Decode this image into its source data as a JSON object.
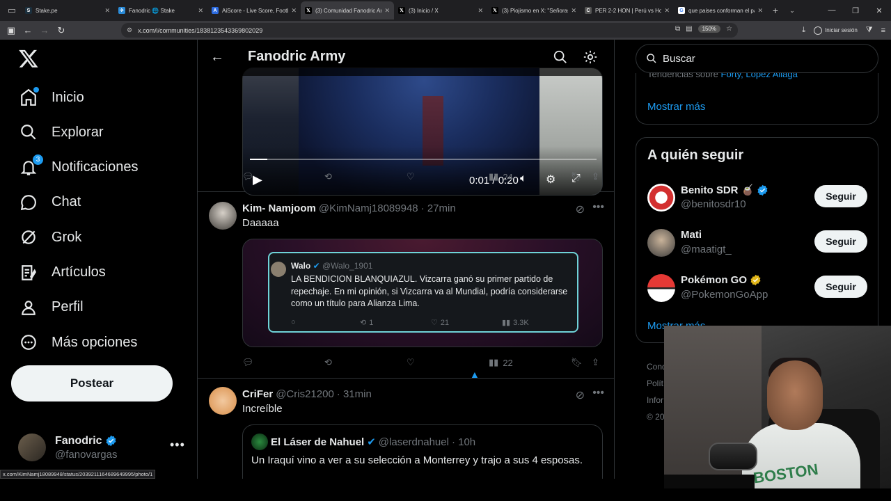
{
  "browser": {
    "tabs": [
      {
        "title": "Stake.pe",
        "color": "#1b2f3d",
        "glyph": "S"
      },
      {
        "title": "Fanodric 🌐 Stake",
        "color": "#2a8bd8",
        "glyph": "✈"
      },
      {
        "title": "AiScore - Live Score, Footb",
        "color": "#2c6be0",
        "glyph": "A"
      },
      {
        "title": "(3) Comunidad Fanodric Ar",
        "color": "#000000",
        "glyph": "𝕏"
      },
      {
        "title": "(3) Inicio / X",
        "color": "#000000",
        "glyph": "𝕏"
      },
      {
        "title": "(3) Piojismo en X: \"Señoras",
        "color": "#000000",
        "glyph": "𝕏"
      },
      {
        "title": "PER 2-2 HON | Perú vs Hon",
        "color": "#555555",
        "glyph": "C"
      },
      {
        "title": "que paises conforman el pa",
        "color": "#ffffff",
        "glyph": "G"
      }
    ],
    "active_tab_index": 3,
    "url": "x.com/i/communities/1838123543369802029",
    "zoom": "150%",
    "signin": "Iniciar sesión",
    "status_url": "x.com/KimNamj18089948/status/2039211164689649995/photo/1"
  },
  "nav": {
    "items": [
      {
        "label": "Inicio",
        "icon": "home-icon"
      },
      {
        "label": "Explorar",
        "icon": "search-icon"
      },
      {
        "label": "Notificaciones",
        "icon": "bell-icon",
        "badge": "3"
      },
      {
        "label": "Chat",
        "icon": "chat-icon"
      },
      {
        "label": "Grok",
        "icon": "grok-icon"
      },
      {
        "label": "Artículos",
        "icon": "articles-icon"
      },
      {
        "label": "Perfil",
        "icon": "profile-icon"
      },
      {
        "label": "Más opciones",
        "icon": "more-icon"
      }
    ],
    "post_button": "Postear",
    "me": {
      "name": "Fanodric",
      "handle": "@fanovargas"
    }
  },
  "header": {
    "title": "Fanodric Army"
  },
  "video": {
    "time": "0:01 / 0:20",
    "progress": 0.05
  },
  "tweet1_actions": {
    "views": "24"
  },
  "tweet2": {
    "name": "Kim- Namjoom",
    "handle": "@KimNamj18089948",
    "time": "· 27min",
    "text": "Daaaaa",
    "inner": {
      "name": "Walo",
      "handle": "@Walo_1901",
      "text": "LA BENDICION BLANQUIAZUL. Vizcarra ganó su primer partido de repechaje. En mi opinión, si Vizcarra va al Mundial, podría considerarse como un título para Alianza Lima.",
      "retweets": "1",
      "likes": "21",
      "views": "3.3K"
    },
    "views": "22"
  },
  "tweet3": {
    "name": "CriFer",
    "handle": "@Cris21200",
    "time": "· 31min",
    "text": "Increíble",
    "quote": {
      "name": "El Láser de Nahuel",
      "handle": "@laserdnahuel",
      "time": "· 10h",
      "text": "Un Iraquí vino a ver a su selección a Monterrey y trajo a sus 4 esposas."
    }
  },
  "right": {
    "search_placeholder": "Buscar",
    "trends_prefix": "Tendencias sobre",
    "trends_links": "Forty, López Aliaga",
    "show_more": "Mostrar más",
    "who_to_follow": "A quién seguir",
    "follow_label": "Seguir",
    "accounts": [
      {
        "name": "Benito SDR",
        "handle": "@benitosdr10",
        "badge": "#1d9bf0",
        "emoji": "🧉"
      },
      {
        "name": "Mati",
        "handle": "@maatigt_",
        "badge": "",
        "emoji": ""
      },
      {
        "name": "Pokémon GO",
        "handle": "@PokemonGoApp",
        "badge": "#e2b719",
        "emoji": ""
      }
    ],
    "show_more2": "Mostrar más",
    "footer": [
      "Cond",
      "Polít",
      "Infor",
      "© 20"
    ]
  },
  "webcam_text": "BOSTON"
}
